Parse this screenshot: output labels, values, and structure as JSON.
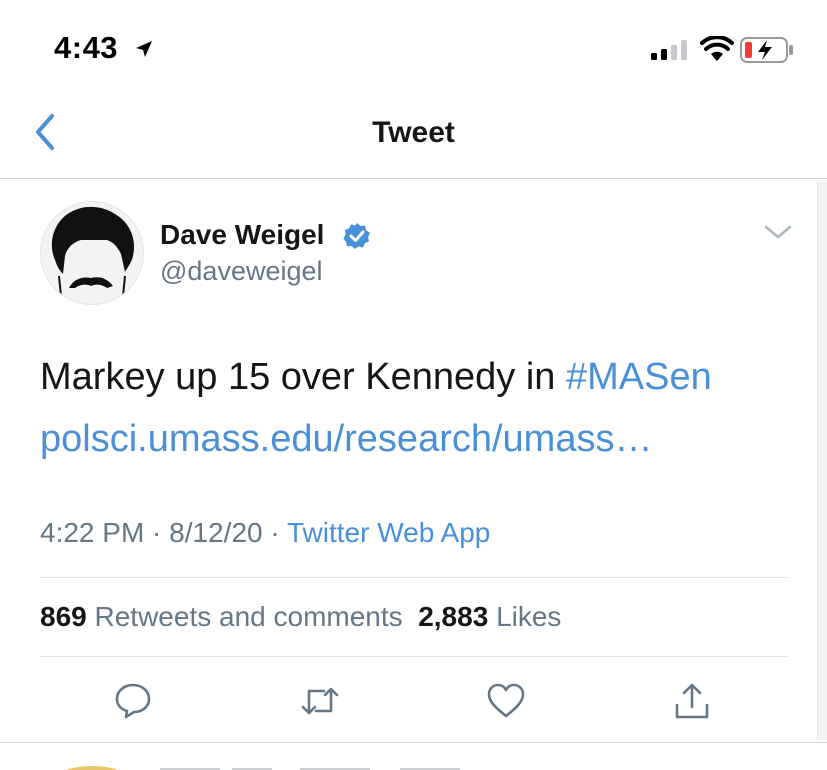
{
  "status_bar": {
    "time": "4:43",
    "battery_color": "#ef3e36"
  },
  "nav": {
    "title": "Tweet",
    "accent": "#4a90d9"
  },
  "tweet": {
    "author_name": "Dave Weigel",
    "handle": "@daveweigel",
    "text": "Markey up 15 over Kennedy in ",
    "hashtag": "#MASen",
    "link": "polsci.umass.edu/research/umass…",
    "time": "4:22 PM",
    "sep1": " · ",
    "date": "8/12/20",
    "sep2": " · ",
    "source": "Twitter Web App",
    "retweets_count": "869",
    "retweets_label": "Retweets and comments",
    "likes_count": "2,883",
    "likes_label": "Likes"
  },
  "actions": [
    "reply-icon",
    "retweet-icon",
    "like-icon",
    "share-icon"
  ]
}
